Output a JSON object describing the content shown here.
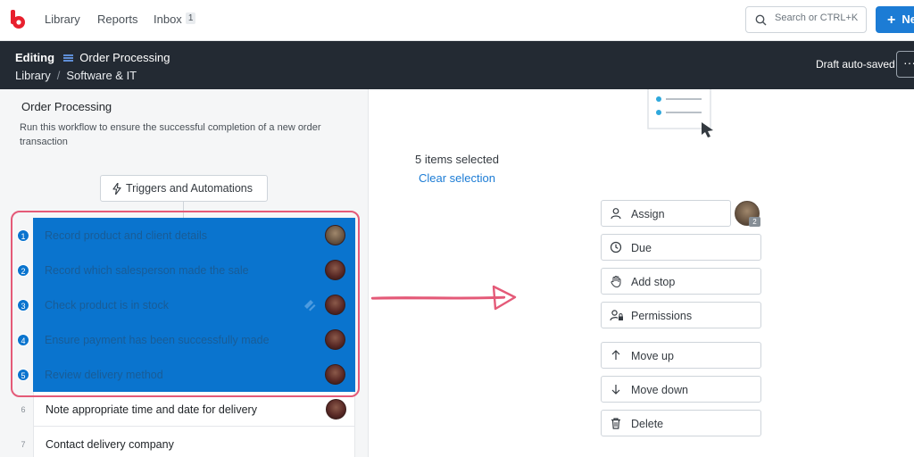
{
  "topnav": {
    "links": [
      "Library",
      "Reports",
      "Inbox"
    ],
    "inbox_badge": "1",
    "search_placeholder": "Search or CTRL+K",
    "new_label": "Ne"
  },
  "editbar": {
    "editing_label": "Editing",
    "workflow_title": "Order Processing",
    "breadcrumb": [
      "Library",
      "Software & IT"
    ],
    "breadcrumb_sep": "/",
    "status": "Draft auto-saved",
    "more_label": "···"
  },
  "workflow": {
    "name": "Order Processing",
    "description": "Run this workflow to ensure the successful completion of a new order transaction",
    "triggers_label": "Triggers and Automations"
  },
  "tasks": [
    {
      "num": "1",
      "text": "Record product and client details",
      "selected": true
    },
    {
      "num": "2",
      "text": "Record which salesperson made the sale",
      "selected": true
    },
    {
      "num": "3",
      "text": "Check product is in stock",
      "selected": true
    },
    {
      "num": "4",
      "text": "Ensure payment has been successfully made",
      "selected": true
    },
    {
      "num": "5",
      "text": "Review delivery method",
      "selected": true
    },
    {
      "num": "6",
      "text": "Note appropriate time and date for delivery",
      "selected": false
    },
    {
      "num": "7",
      "text": "Contact delivery company",
      "selected": false
    }
  ],
  "selection": {
    "count_text": "5 items selected",
    "clear_label": "Clear selection",
    "assignee_count": "2"
  },
  "actions": {
    "assign": "Assign",
    "due": "Due",
    "add_stop": "Add stop",
    "permissions": "Permissions",
    "move_up": "Move up",
    "move_down": "Move down",
    "delete": "Delete"
  },
  "colors": {
    "accent": "#1c7cd5",
    "header_bg": "#232a33",
    "selection": "#0a74ce",
    "highlight": "#e45a78"
  }
}
